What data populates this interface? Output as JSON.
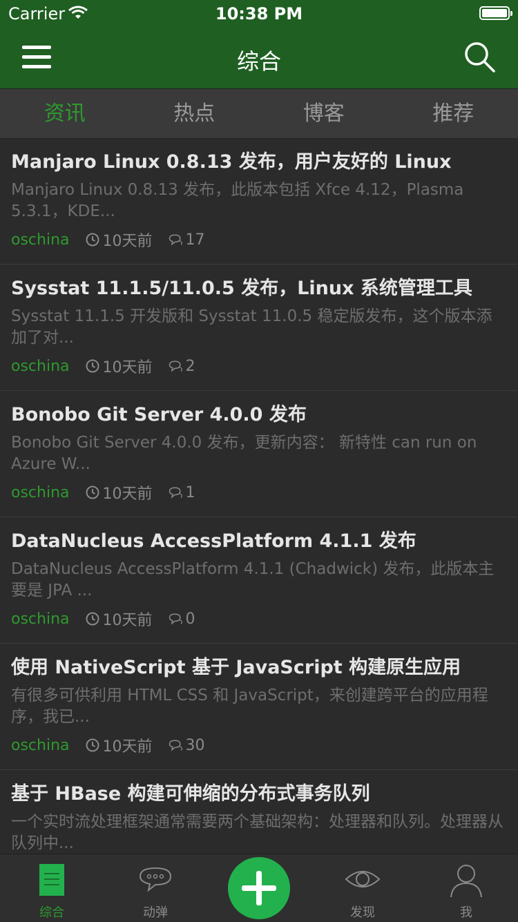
{
  "status_bar": {
    "carrier": "Carrier",
    "time": "10:38 PM"
  },
  "nav": {
    "title": "综合"
  },
  "tabs": [
    {
      "label": "资讯"
    },
    {
      "label": "热点"
    },
    {
      "label": "博客"
    },
    {
      "label": "推荐"
    }
  ],
  "news": [
    {
      "title": "Manjaro Linux 0.8.13 发布，用户友好的 Linux",
      "summary": "Manjaro Linux 0.8.13 发布，此版本包括 Xfce 4.12，Plasma 5.3.1，KDE...",
      "source": "oschina",
      "time": "10天前",
      "comments": "17"
    },
    {
      "title": "Sysstat 11.1.5/11.0.5 发布，Linux 系统管理工具",
      "summary": "Sysstat 11.1.5 开发版和 Sysstat 11.0.5 稳定版发布，这个版本添加了对...",
      "source": "oschina",
      "time": "10天前",
      "comments": "2"
    },
    {
      "title": "Bonobo Git Server 4.0.0 发布",
      "summary": "Bonobo Git Server 4.0.0 发布，更新内容： 新特性 can run on Azure W...",
      "source": "oschina",
      "time": "10天前",
      "comments": "1"
    },
    {
      "title": "DataNucleus AccessPlatform 4.1.1 发布",
      "summary": "DataNucleus AccessPlatform 4.1.1 (Chadwick) 发布，此版本主要是 JPA ...",
      "source": "oschina",
      "time": "10天前",
      "comments": "0"
    },
    {
      "title": "使用 NativeScript 基于 JavaScript 构建原生应用",
      "summary": "有很多可供利用 HTML CSS 和 JavaScript，来创建跨平台的应用程序，我已...",
      "source": "oschina",
      "time": "10天前",
      "comments": "30"
    },
    {
      "title": "基于 HBase 构建可伸缩的分布式事务队列",
      "summary": "一个实时流处理框架通常需要两个基础架构：处理器和队列。处理器从队列中...",
      "source": "",
      "time": "",
      "comments": ""
    }
  ],
  "tabbar": {
    "items": [
      {
        "label": "综合",
        "icon": "document-icon"
      },
      {
        "label": "动弹",
        "icon": "chat-bubble-icon"
      },
      {
        "label": "",
        "icon": "plus-icon"
      },
      {
        "label": "发现",
        "icon": "eye-icon"
      },
      {
        "label": "我",
        "icon": "person-icon"
      }
    ]
  },
  "colors": {
    "accent": "#2e9a2e",
    "nav_bg": "#1f5f22",
    "plus_bg": "#23b14d",
    "bg": "#2b2b2b"
  }
}
